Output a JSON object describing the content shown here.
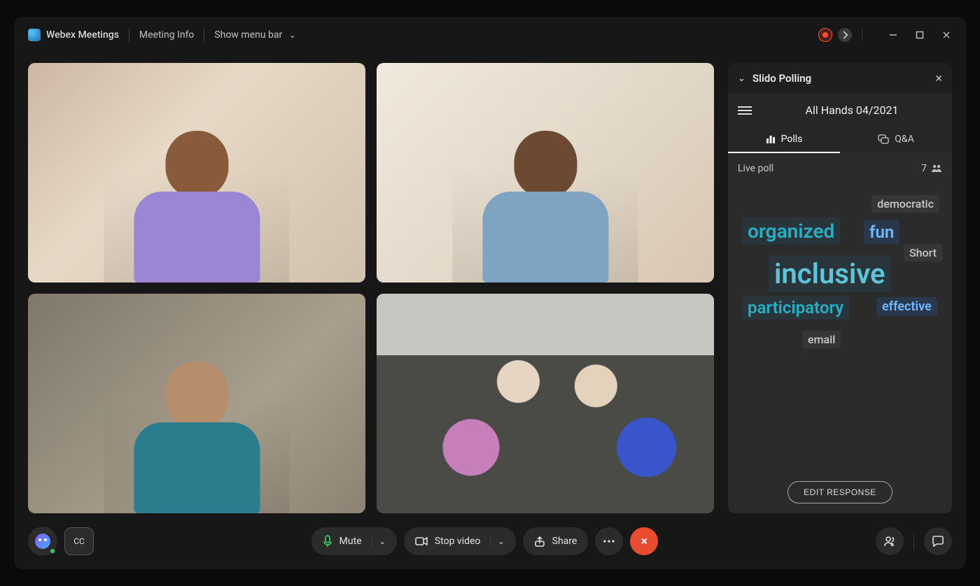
{
  "header": {
    "app_name": "Webex Meetings",
    "meeting_info": "Meeting Info",
    "show_menu": "Show menu bar"
  },
  "panel": {
    "title": "Slido Polling",
    "event_title": "All Hands 04/2021",
    "tabs": {
      "polls": "Polls",
      "qa": "Q&A"
    },
    "poll_status": "Live poll",
    "participant_count": "7",
    "words": {
      "democratic": "democratic",
      "organized": "organized",
      "fun": "fun",
      "short": "Short",
      "inclusive": "inclusive",
      "participatory": "participatory",
      "effective": "effective",
      "email": "email"
    },
    "edit_button": "EDIT RESPONSE"
  },
  "toolbar": {
    "cc": "CC",
    "mute": "Mute",
    "stop_video": "Stop video",
    "share": "Share"
  }
}
